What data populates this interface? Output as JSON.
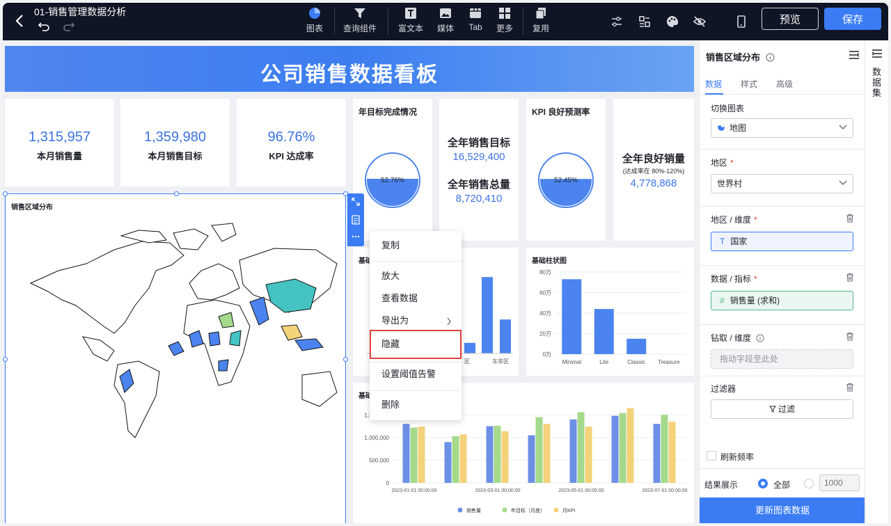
{
  "header": {
    "title": "01-销售管理数据分析",
    "tools": [
      "图表",
      "查询组件",
      "富文本",
      "媒体",
      "Tab",
      "更多",
      "复用"
    ],
    "preview": "预览",
    "save": "保存"
  },
  "dashboard": {
    "banner": "公司销售数据看板",
    "kpis": [
      {
        "value": "1,315,957",
        "label": "本月销售量"
      },
      {
        "value": "1,359,980",
        "label": "本月销售目标"
      },
      {
        "value": "96.76%",
        "label": "KPI 达成率"
      }
    ],
    "gauge1": {
      "title": "年目标完成情况",
      "value": "52.76%",
      "fraction": 0.5276
    },
    "annual": {
      "target_label": "全年销售目标",
      "target_value": "16,529,400",
      "total_label": "全年销售总量",
      "total_value": "8,720,410"
    },
    "gauge2": {
      "title": "KPI 良好预测率",
      "value": "52.45%",
      "fraction": 0.5245
    },
    "good": {
      "label": "全年良好销量",
      "note": "(达成率在 80%-120%)",
      "value": "4,778,868"
    },
    "map_title": "销售区域分布",
    "partial_titles": [
      "基础",
      "基础"
    ]
  },
  "context_menu": [
    "复制",
    "放大",
    "查看数据",
    "导出为",
    "隐藏",
    "设置阈值告警",
    "删除"
  ],
  "panel": {
    "title": "销售区域分布",
    "tabs": [
      "数据",
      "样式",
      "高级"
    ],
    "switch_chart_label": "切换图表",
    "chart_type": "地图",
    "region_label": "地区",
    "region_value": "世界村",
    "dim_label": "地区 / 维度",
    "dim_value": "国家",
    "metric_label": "数据 / 指标",
    "metric_value": "销售量 (求和)",
    "drill_label": "钻取 / 维度",
    "drill_placeholder": "拖动字段至此处",
    "filter_label": "过滤器",
    "filter_button": "过滤",
    "refresh_label": "刷新频率",
    "result_label": "结果展示",
    "result_all": "全部",
    "result_limit": "1000",
    "update_button": "更新图表数据"
  },
  "side_strip": "数据集",
  "chart_data": [
    {
      "type": "bar",
      "title": "",
      "categories": [
        "",
        "",
        "",
        "",
        "东非区"
      ],
      "values": [
        null,
        null,
        5,
        36,
        16
      ],
      "partial_x_labels": [
        "区",
        "东非区"
      ],
      "y_ticks_visible": [
        "",
        "",
        "",
        "",
        ""
      ]
    },
    {
      "type": "bar",
      "title": "基础柱状图",
      "categories": [
        "Minimal",
        "Lite",
        "Classic",
        "Treasure"
      ],
      "values": [
        730000,
        440000,
        150000,
        0
      ],
      "y_ticks": [
        "0万",
        "20万",
        "40万",
        "60万",
        "80万"
      ],
      "ylim": [
        0,
        800000
      ]
    },
    {
      "type": "bar",
      "title": "",
      "categories": [
        "2023-01-01 00:00:00",
        "",
        "2023-03-01 00:00:00",
        "",
        "2023-05-01 00:00:00",
        "",
        "2023-07-01 00:00:00"
      ],
      "y_ticks": [
        "0",
        "500,000",
        "1,000,000",
        "1,500,000"
      ],
      "ylim": [
        0,
        1750000
      ],
      "series": [
        {
          "name": "销售量",
          "values": [
            1300000,
            900000,
            1250000,
            1050000,
            1400000,
            1480000,
            1300000
          ],
          "color": "#6d8fe6"
        },
        {
          "name": "年目标（月度）",
          "values": [
            1220000,
            1030000,
            1260000,
            1450000,
            1560000,
            1540000,
            1500000
          ],
          "color": "#a5d98c"
        },
        {
          "name": "月KPI",
          "values": [
            1240000,
            1070000,
            1140000,
            1300000,
            1240000,
            1650000,
            1350000
          ],
          "color": "#f3d27a"
        }
      ]
    }
  ]
}
